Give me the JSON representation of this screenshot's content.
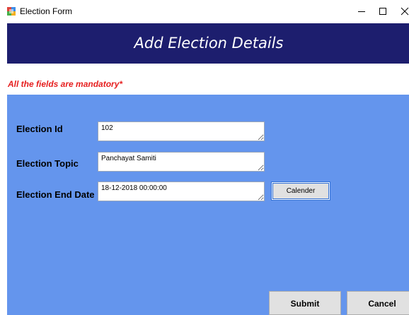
{
  "window": {
    "title": "Election Form",
    "icon": "form-app-icon",
    "controls": {
      "minimize_icon": "minimize-icon",
      "maximize_icon": "maximize-icon",
      "close_icon": "close-icon"
    }
  },
  "header": {
    "title": "Add Election Details",
    "background": "#1d1e6e",
    "text_color": "#ffffff"
  },
  "notice": {
    "text": "All the fields are mandatory*",
    "color": "#e61e1e"
  },
  "form": {
    "background": "#6495ed",
    "fields": {
      "election_id": {
        "label": "Election Id",
        "value": "102"
      },
      "election_topic": {
        "label": "Election Topic",
        "value": "Panchayat Samiti"
      },
      "election_end_date": {
        "label": "Election End Date",
        "value": "18-12-2018 00:00:00"
      }
    },
    "calendar_button": "Calender"
  },
  "actions": {
    "submit_label": "Submit",
    "cancel_label": "Cancel"
  }
}
